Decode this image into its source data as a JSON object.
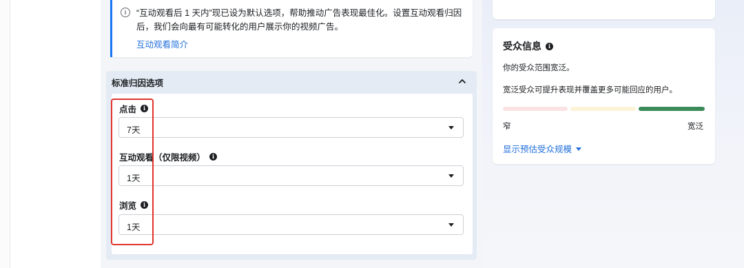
{
  "info_banner": {
    "text": "“互动观看后 1 天内”现已设为默认选项，帮助推动广告表现最佳化。设置互动观看归因后，我们会向最有可能转化的用户展示你的视频广告。",
    "link": "互动观看简介",
    "icon": "info-circle-icon"
  },
  "attribution": {
    "title": "标准归因选项",
    "fields": [
      {
        "label": "点击",
        "value": "7天"
      },
      {
        "label": "互动观看（仅限视频）",
        "value": "1天"
      },
      {
        "label": "浏览",
        "value": "1天"
      }
    ]
  },
  "audience": {
    "title": "受众信息",
    "line1": "你的受众范围宽泛。",
    "line2": "宽泛受众可提升表现并覆盖更多可能回应的用户。",
    "narrow": "窄",
    "broad": "宽泛",
    "show_size": "显示预估受众规模",
    "colors": {
      "narrow": "#fbe3e4",
      "mid": "#fdf3d8",
      "broad": "#3b8a59"
    }
  },
  "colors": {
    "highlight": "#e0332a",
    "link": "#216fdb",
    "accent": "#1877f2"
  }
}
